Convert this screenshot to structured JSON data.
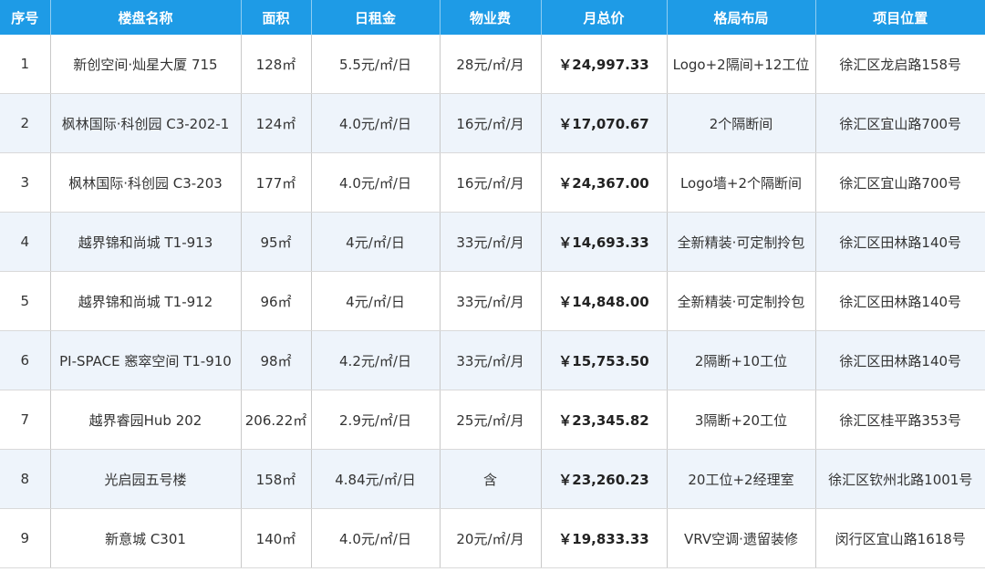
{
  "headers": [
    "序号",
    "楼盘名称",
    "面积",
    "日租金",
    "物业费",
    "月总价",
    "格局布局",
    "项目位置"
  ],
  "rows": [
    {
      "no": "1",
      "name": "新创空间·灿星大厦  715",
      "area": "128㎡",
      "rent": "5.5元/㎡/日",
      "fee": "28元/㎡/月",
      "price": "￥24,997.33",
      "layout": "Logo+2隔间+12工位",
      "location": "徐汇区龙启路158号"
    },
    {
      "no": "2",
      "name": "枫林国际·科创园  C3-202-1",
      "area": "124㎡",
      "rent": "4.0元/㎡/日",
      "fee": "16元/㎡/月",
      "price": "￥17,070.67",
      "layout": "2个隔断间",
      "location": "徐汇区宜山路700号"
    },
    {
      "no": "3",
      "name": "枫林国际·科创园  C3-203",
      "area": "177㎡",
      "rent": "4.0元/㎡/日",
      "fee": "16元/㎡/月",
      "price": "￥24,367.00",
      "layout": "Logo墙+2个隔断间",
      "location": "徐汇区宜山路700号"
    },
    {
      "no": "4",
      "name": "越界锦和尚城  T1-913",
      "area": "95㎡",
      "rent": "4元/㎡/日",
      "fee": "33元/㎡/月",
      "price": "￥14,693.33",
      "layout": "全新精装·可定制拎包",
      "location": "徐汇区田林路140号"
    },
    {
      "no": "5",
      "name": "越界锦和尚城 T1-912",
      "area": "96㎡",
      "rent": "4元/㎡/日",
      "fee": "33元/㎡/月",
      "price": "￥14,848.00",
      "layout": "全新精装·可定制拎包",
      "location": "徐汇区田林路140号"
    },
    {
      "no": "6",
      "name": "PI-SPACE 窸窣空间   T1-910",
      "area": "98㎡",
      "rent": "4.2元/㎡/日",
      "fee": "33元/㎡/月",
      "price": "￥15,753.50",
      "layout": "2隔断+10工位",
      "location": "徐汇区田林路140号"
    },
    {
      "no": "7",
      "name": "越界睿园Hub 202",
      "area": "206.22㎡",
      "rent": "2.9元/㎡/日",
      "fee": "25元/㎡/月",
      "price": "￥23,345.82",
      "layout": "3隔断+20工位",
      "location": "徐汇区桂平路353号"
    },
    {
      "no": "8",
      "name": "光启园五号楼",
      "area": "158㎡",
      "rent": "4.84元/㎡/日",
      "fee": "含",
      "price": "￥23,260.23",
      "layout": "20工位+2经理室",
      "location": "徐汇区钦州北路1001号"
    },
    {
      "no": "9",
      "name": "新意城 C301",
      "area": "140㎡",
      "rent": "4.0元/㎡/日",
      "fee": "20元/㎡/月",
      "price": "￥19,833.33",
      "layout": "VRV空调·遗留装修",
      "location": "闵行区宜山路1618号"
    }
  ]
}
